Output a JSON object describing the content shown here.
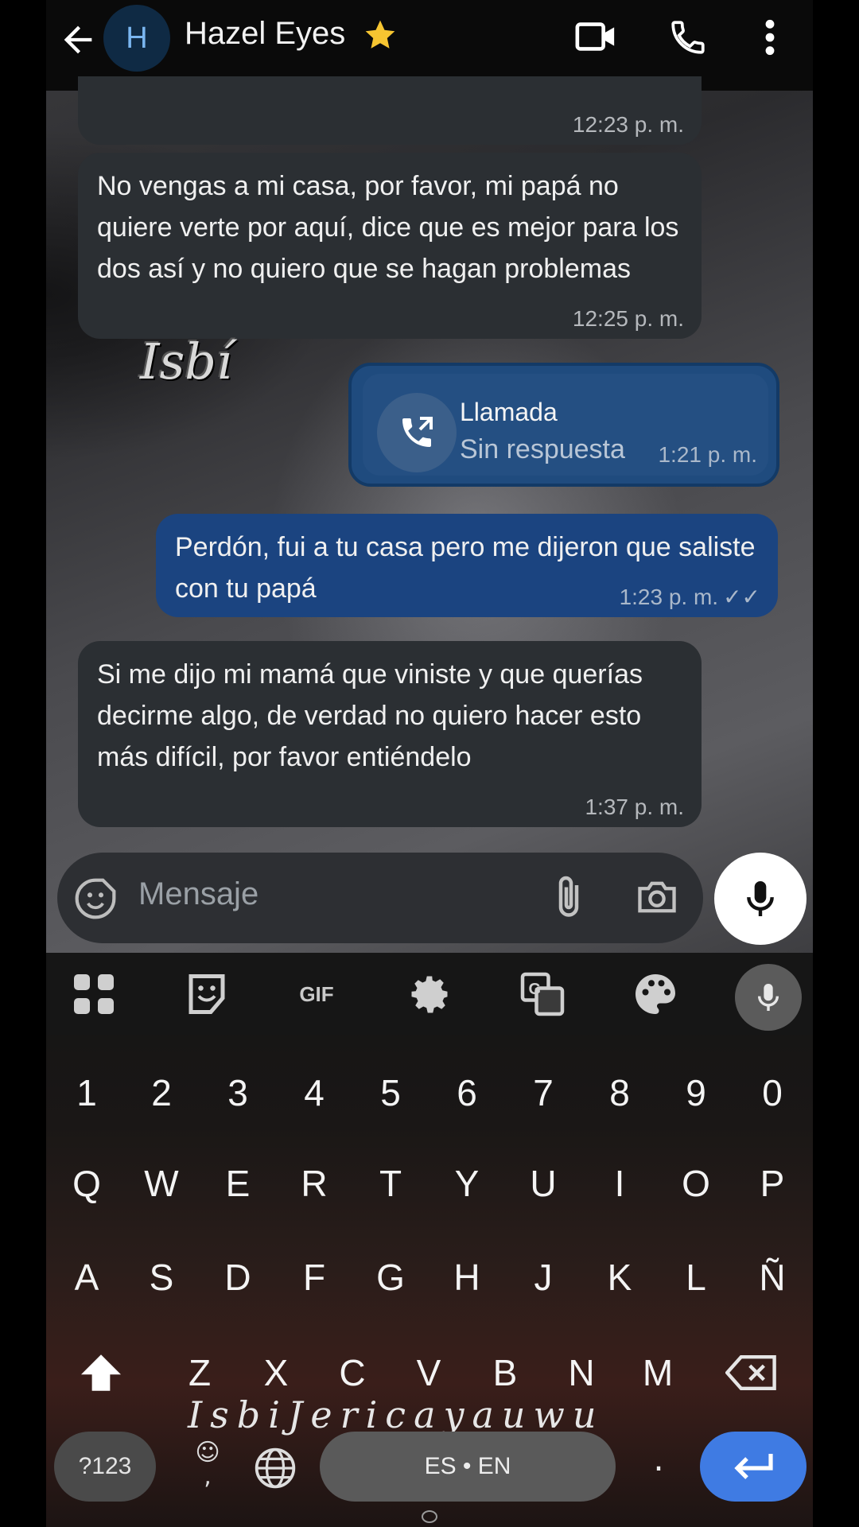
{
  "header": {
    "avatar_letter": "H",
    "contact_name": "Hazel Eyes",
    "icons": [
      "back-arrow-icon",
      "star-icon",
      "video-call-icon",
      "phone-icon",
      "more-vert-icon"
    ]
  },
  "messages": [
    {
      "direction": "in",
      "text": "",
      "time": "12:23 p. m."
    },
    {
      "direction": "in",
      "text": "No vengas a mi casa, por favor, mi papá no quiere verte por aquí, dice que es mejor para los dos así y no quiero que se hagan problemas",
      "time": "12:25 p. m."
    },
    {
      "direction": "out",
      "type": "call",
      "title": "Llamada",
      "subtitle": "Sin respuesta",
      "time": "1:21 p. m."
    },
    {
      "direction": "out",
      "text": "Perdón, fui a tu casa pero me dijeron que saliste con tu papá",
      "time": "1:23 p. m.",
      "status": "read"
    },
    {
      "direction": "in",
      "text": "Si me dijo mi mamá que viniste y que querías decirme algo, de verdad no quiero hacer esto más difícil, por favor entiéndelo",
      "time": "1:37 p. m."
    }
  ],
  "composer": {
    "placeholder": "Mensaje",
    "icons": [
      "sticker-icon",
      "attach-icon",
      "camera-icon",
      "mic-icon"
    ]
  },
  "keyboard": {
    "toolbar": [
      "apps-grid-icon",
      "sticker-icon",
      "GIF",
      "settings-icon",
      "translate-icon",
      "palette-icon",
      "mic-icon"
    ],
    "gif_label": "GIF",
    "number_row": [
      "1",
      "2",
      "3",
      "4",
      "5",
      "6",
      "7",
      "8",
      "9",
      "0"
    ],
    "row1": [
      "Q",
      "W",
      "E",
      "R",
      "T",
      "Y",
      "U",
      "I",
      "O",
      "P"
    ],
    "row2": [
      "A",
      "S",
      "D",
      "F",
      "G",
      "H",
      "J",
      "K",
      "L",
      "Ñ"
    ],
    "row3": [
      "Z",
      "X",
      "C",
      "V",
      "B",
      "N",
      "M"
    ],
    "mode_key": "?123",
    "emoji_key": ",",
    "space_label": "ES • EN",
    "period": "."
  },
  "overlay": {
    "signature": "Isbí",
    "watermark": "IsbiJericayauwu"
  },
  "colors": {
    "incoming_bubble": "#2b2f33",
    "outgoing_bubble": "#1b3a63",
    "enter_key": "#3f7be3"
  }
}
